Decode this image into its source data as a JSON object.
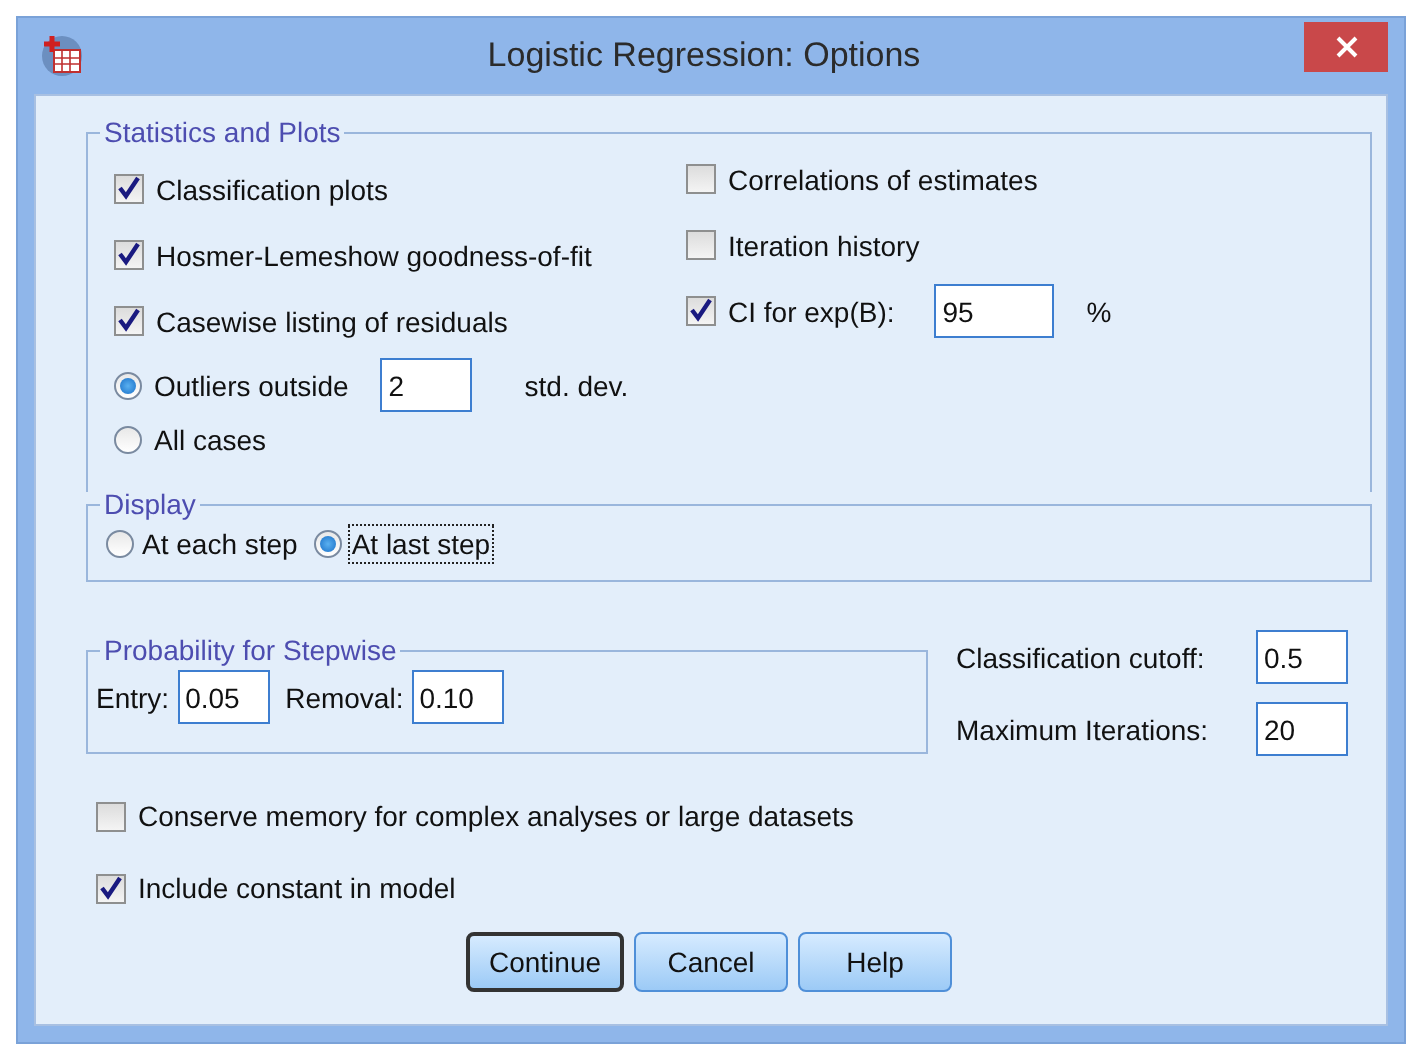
{
  "window": {
    "title": "Logistic Regression: Options"
  },
  "statistics_and_plots": {
    "title": "Statistics and Plots",
    "left": [
      {
        "label": "Classification plots",
        "checked": true
      },
      {
        "label": "Hosmer-Lemeshow goodness-of-fit",
        "checked": true
      },
      {
        "label": "Casewise listing of residuals",
        "checked": true
      }
    ],
    "residuals": [
      {
        "label": "Outliers outside",
        "selected": true,
        "value": "2",
        "unit": "std. dev."
      },
      {
        "label": "All cases",
        "selected": false
      }
    ],
    "right": [
      {
        "label": "Correlations of estimates",
        "checked": false
      },
      {
        "label": "Iteration history",
        "checked": false
      },
      {
        "label": "CI for exp(B):",
        "checked": true,
        "value": "95",
        "unit": "%"
      }
    ]
  },
  "display": {
    "title": "Display",
    "options": [
      {
        "label": "At each step",
        "selected": false,
        "focused": false
      },
      {
        "label": "At last step",
        "selected": true,
        "focused": true
      }
    ]
  },
  "probability_for_stepwise": {
    "title": "Probability for Stepwise",
    "fields": [
      {
        "label": "Entry:",
        "value": "0.05"
      },
      {
        "label": "Removal:",
        "value": "0.10"
      }
    ]
  },
  "settings": [
    {
      "label": "Classification cutoff:",
      "value": "0.5"
    },
    {
      "label": "Maximum Iterations:",
      "value": "20"
    }
  ],
  "options": [
    {
      "label": "Conserve memory for complex analyses or large datasets",
      "checked": false
    },
    {
      "label": "Include constant in model",
      "checked": true
    }
  ],
  "buttons": [
    {
      "label": "Continue",
      "default": true
    },
    {
      "label": "Cancel",
      "default": false
    },
    {
      "label": "Help",
      "default": false
    }
  ]
}
